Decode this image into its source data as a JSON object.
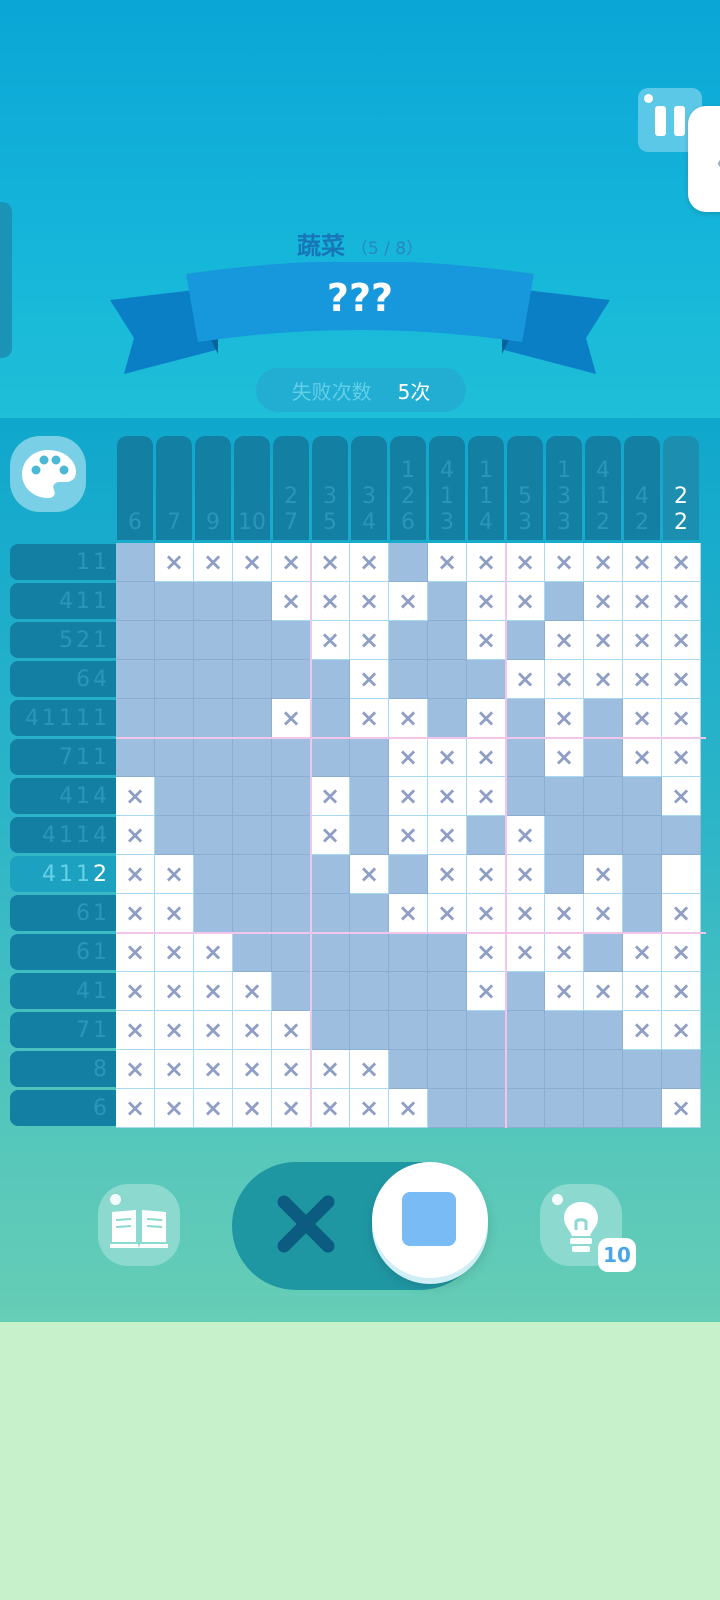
{
  "header": {
    "category": "蔬菜",
    "progress": "（5 / 8）",
    "puzzle_name": "???",
    "fail_label": "失败次数",
    "fail_value": "5次"
  },
  "icons": {
    "pause": "pause-icon",
    "side_handle": "chevron-left-icon",
    "palette": "palette-icon",
    "book": "book-icon",
    "cross_mode": "cross-icon",
    "fill_mode": "square-icon",
    "hint": "lightbulb-icon"
  },
  "column_clues": [
    [
      "6"
    ],
    [
      "7"
    ],
    [
      "9"
    ],
    [
      "10"
    ],
    [
      "2",
      "7"
    ],
    [
      "3",
      "5"
    ],
    [
      "3",
      "4"
    ],
    [
      "1",
      "2",
      "6"
    ],
    [
      "4",
      "1",
      "3"
    ],
    [
      "1",
      "1",
      "4"
    ],
    [
      "5",
      "3"
    ],
    [
      "1",
      "3",
      "3"
    ],
    [
      "4",
      "1",
      "2"
    ],
    [
      "4",
      "2"
    ],
    [
      "2",
      "2"
    ]
  ],
  "active_column": 14,
  "row_clues": [
    [
      "1",
      "1"
    ],
    [
      "4",
      "1",
      "1"
    ],
    [
      "5",
      "2",
      "1"
    ],
    [
      "6",
      "4"
    ],
    [
      "4",
      "1",
      "1",
      "1",
      "1"
    ],
    [
      "7",
      "1",
      "1"
    ],
    [
      "4",
      "1",
      "4"
    ],
    [
      "4",
      "1",
      "1",
      "4"
    ],
    [
      "4",
      "1",
      "1",
      "2"
    ],
    [
      "6",
      "1"
    ],
    [
      "6",
      "1"
    ],
    [
      "4",
      "1"
    ],
    [
      "7",
      "1"
    ],
    [
      "8"
    ],
    [
      "6"
    ]
  ],
  "active_row": 8,
  "grid": [
    "fxxxxxxfxxxxxxx",
    "ffffxxxxfxxfxxx",
    "fffffxxffxfxxxx",
    "ffffffxfffxxxxx",
    "ffffxfxxfxfxfxx",
    "fffffffxxxfxfxx",
    "xffffxfxxxffffx",
    "xffffxfxxfxffff",
    "xxffffxfxxxfxfw",
    "xxfffffxxxxxxfx",
    "xxxffffffxxxfxx",
    "xxxxfffffxfxxxxx",
    "xxxxxffffffffxxf",
    "xxxxxxxffffffff",
    "xxxxxxxxffffffx"
  ],
  "hint_count": "10",
  "colors": {
    "filled": "#9ebedf",
    "empty": "#ffffff",
    "cross": "#8e9ec4",
    "clue_bg": "#137fa3",
    "accent": "#79bbf4"
  }
}
